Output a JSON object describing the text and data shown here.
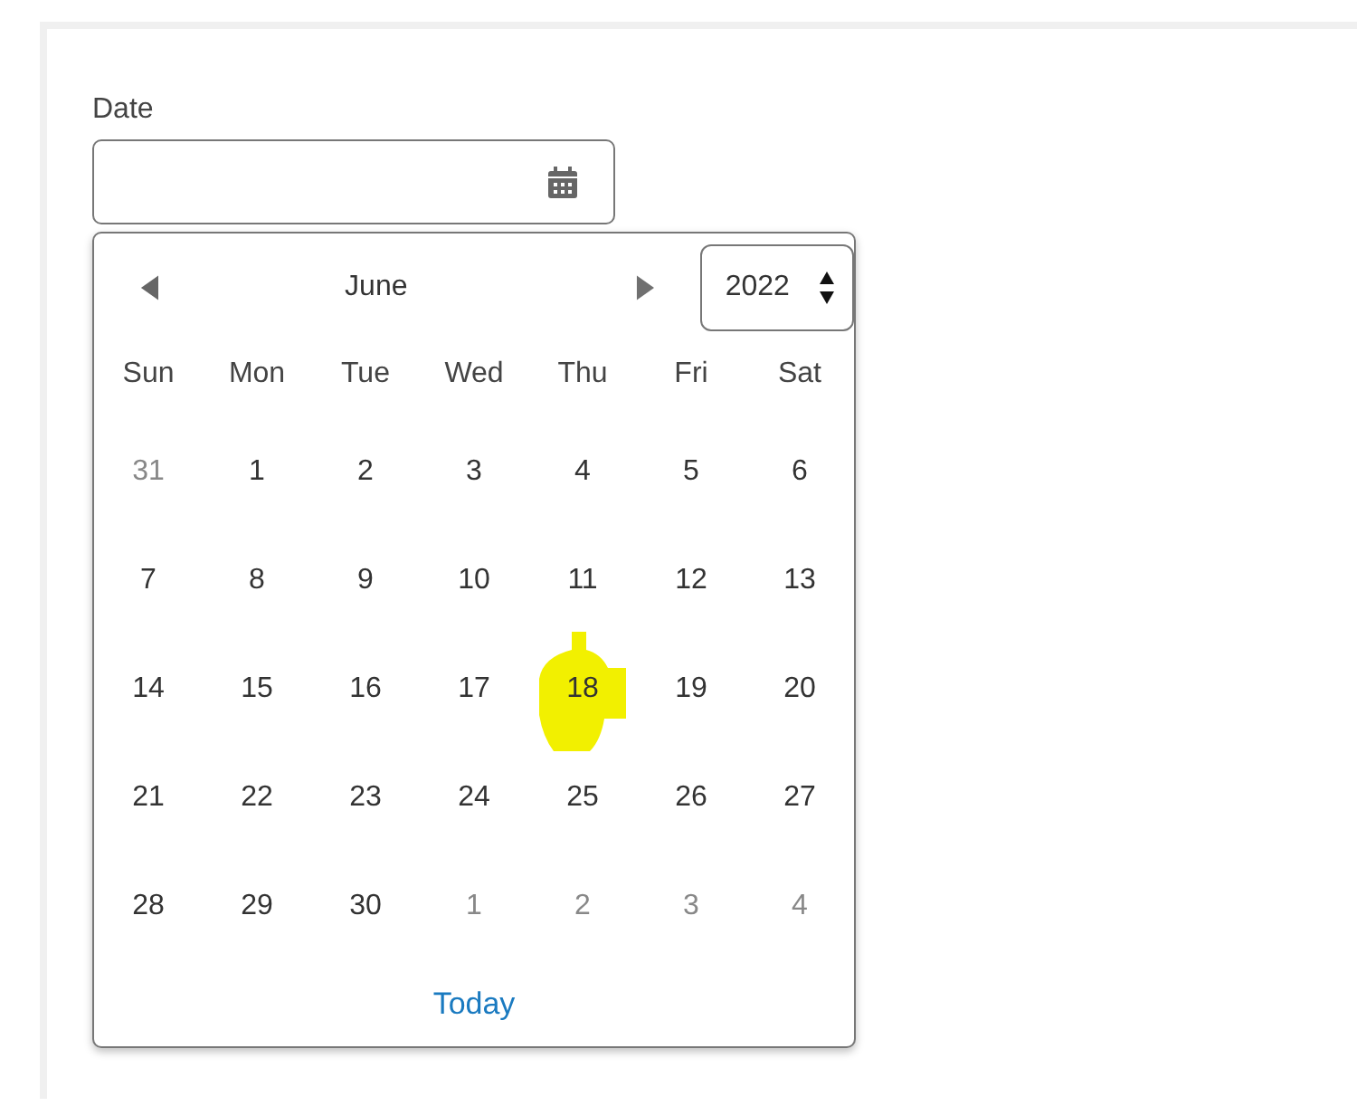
{
  "field": {
    "label": "Date"
  },
  "calendar": {
    "month": "June",
    "year": "2022",
    "weekdays": [
      "Sun",
      "Mon",
      "Tue",
      "Wed",
      "Thu",
      "Fri",
      "Sat"
    ],
    "days": [
      {
        "label": "31",
        "in_month": false,
        "highlighted": false
      },
      {
        "label": "1",
        "in_month": true,
        "highlighted": false
      },
      {
        "label": "2",
        "in_month": true,
        "highlighted": false
      },
      {
        "label": "3",
        "in_month": true,
        "highlighted": false
      },
      {
        "label": "4",
        "in_month": true,
        "highlighted": false
      },
      {
        "label": "5",
        "in_month": true,
        "highlighted": false
      },
      {
        "label": "6",
        "in_month": true,
        "highlighted": false
      },
      {
        "label": "7",
        "in_month": true,
        "highlighted": false
      },
      {
        "label": "8",
        "in_month": true,
        "highlighted": false
      },
      {
        "label": "9",
        "in_month": true,
        "highlighted": false
      },
      {
        "label": "10",
        "in_month": true,
        "highlighted": false
      },
      {
        "label": "11",
        "in_month": true,
        "highlighted": false
      },
      {
        "label": "12",
        "in_month": true,
        "highlighted": false
      },
      {
        "label": "13",
        "in_month": true,
        "highlighted": false
      },
      {
        "label": "14",
        "in_month": true,
        "highlighted": false
      },
      {
        "label": "15",
        "in_month": true,
        "highlighted": false
      },
      {
        "label": "16",
        "in_month": true,
        "highlighted": false
      },
      {
        "label": "17",
        "in_month": true,
        "highlighted": false
      },
      {
        "label": "18",
        "in_month": true,
        "highlighted": true
      },
      {
        "label": "19",
        "in_month": true,
        "highlighted": false
      },
      {
        "label": "20",
        "in_month": true,
        "highlighted": false
      },
      {
        "label": "21",
        "in_month": true,
        "highlighted": false
      },
      {
        "label": "22",
        "in_month": true,
        "highlighted": false
      },
      {
        "label": "23",
        "in_month": true,
        "highlighted": false
      },
      {
        "label": "24",
        "in_month": true,
        "highlighted": false
      },
      {
        "label": "25",
        "in_month": true,
        "highlighted": false
      },
      {
        "label": "26",
        "in_month": true,
        "highlighted": false
      },
      {
        "label": "27",
        "in_month": true,
        "highlighted": false
      },
      {
        "label": "28",
        "in_month": true,
        "highlighted": false
      },
      {
        "label": "29",
        "in_month": true,
        "highlighted": false
      },
      {
        "label": "30",
        "in_month": true,
        "highlighted": false
      },
      {
        "label": "1",
        "in_month": false,
        "highlighted": false
      },
      {
        "label": "2",
        "in_month": false,
        "highlighted": false
      },
      {
        "label": "3",
        "in_month": false,
        "highlighted": false
      },
      {
        "label": "4",
        "in_month": false,
        "highlighted": false
      }
    ],
    "today_link": "Today"
  }
}
